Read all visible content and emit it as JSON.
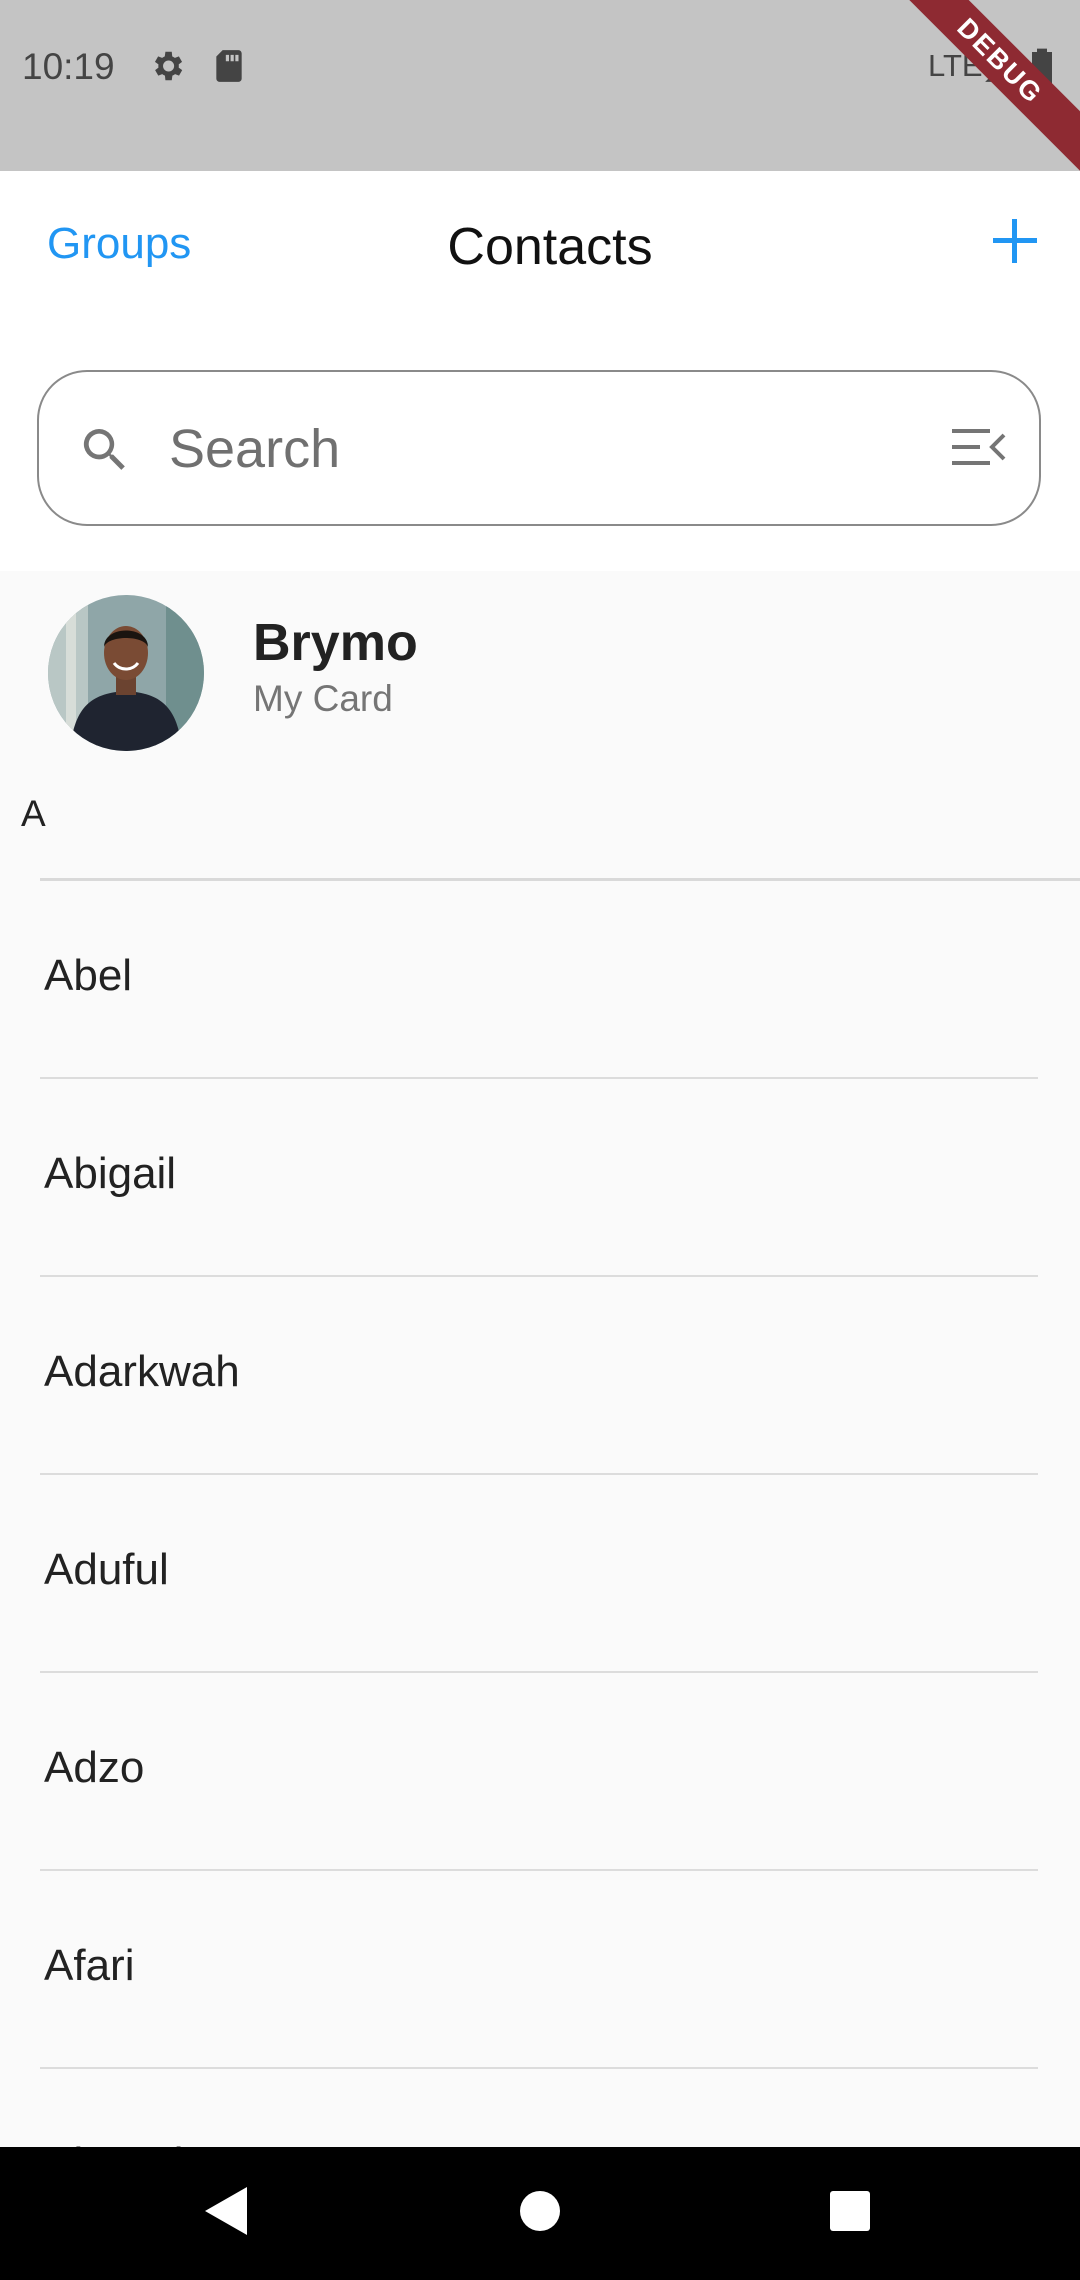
{
  "status_bar": {
    "time": "10:19",
    "network": "LTE",
    "debug_label": "DEBUG",
    "icons": [
      "gear-icon",
      "sd-card-icon",
      "signal-icon",
      "battery-icon"
    ]
  },
  "header": {
    "groups_label": "Groups",
    "title": "Contacts",
    "add_icon": "plus-icon"
  },
  "search": {
    "placeholder": "Search",
    "value": ""
  },
  "my_card": {
    "name": "Brymo",
    "subtitle": "My Card"
  },
  "section": {
    "letter": "A"
  },
  "contacts": [
    {
      "name": "Abel"
    },
    {
      "name": "Abigail"
    },
    {
      "name": "Adarkwah"
    },
    {
      "name": "Aduful"
    },
    {
      "name": "Adzo"
    },
    {
      "name": "Afari"
    },
    {
      "name": "Ahmed"
    }
  ],
  "colors": {
    "accent": "#2196f3",
    "status_bar": "#c4c4c4",
    "background": "#fafafa",
    "debug_banner": "#8e2a32"
  },
  "nav_bar": {
    "buttons": [
      "back-icon",
      "home-icon",
      "recents-icon"
    ]
  }
}
